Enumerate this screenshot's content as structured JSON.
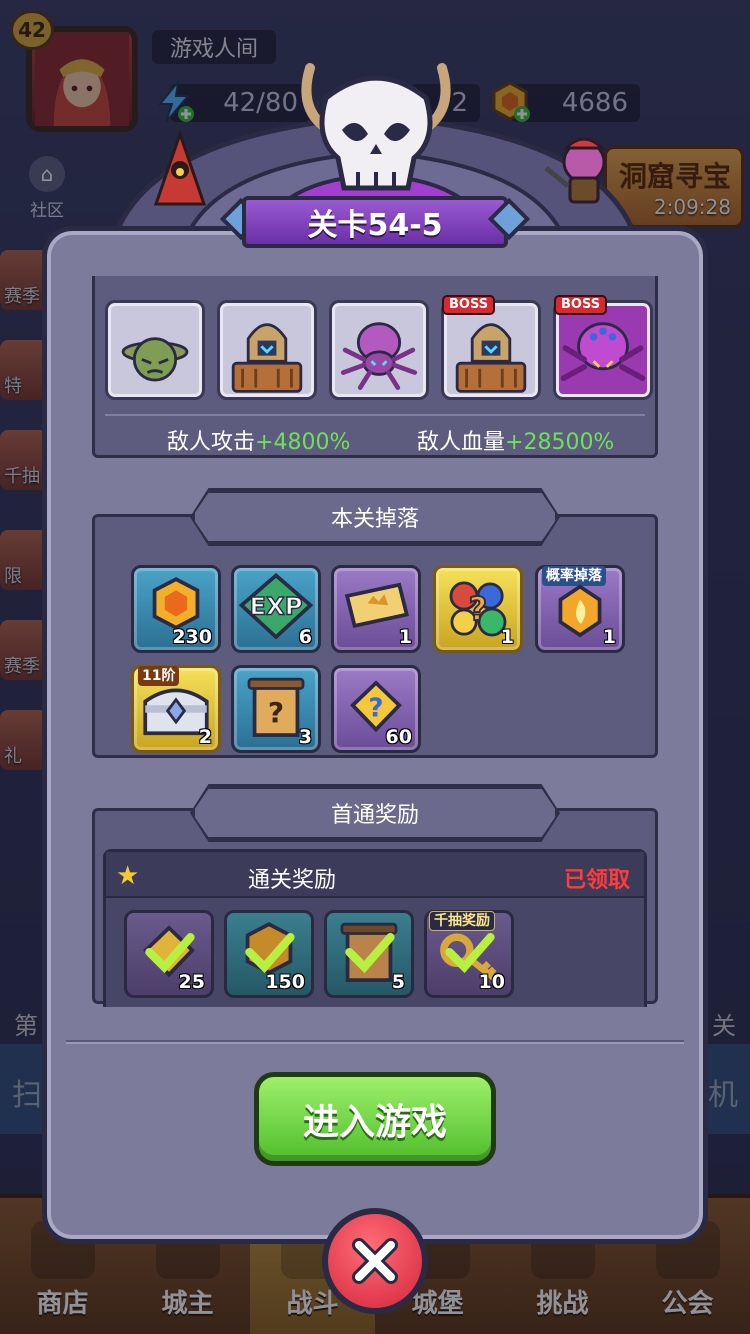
{
  "player": {
    "level": "42",
    "name": "游戏人间"
  },
  "resources": {
    "energy": "42/80",
    "gems_partial": "2",
    "gold": "4686"
  },
  "community_label": "社区",
  "treasure": {
    "title": "洞窟寻宝",
    "timer": "2:09:28"
  },
  "side_labels": [
    "赛季",
    "特",
    "千抽",
    "限",
    "赛季",
    "礼"
  ],
  "background_hints": {
    "left_text": "第",
    "right_text": "关",
    "sweep": "扫",
    "sweep_right": "机"
  },
  "nav": [
    {
      "label": "商店"
    },
    {
      "label": "城主"
    },
    {
      "label": "战斗"
    },
    {
      "label": "城堡"
    },
    {
      "label": "挑战"
    },
    {
      "label": "公会"
    }
  ],
  "stage": {
    "title": "关卡54-5"
  },
  "enemies": [
    {
      "icon": "goblin-icon",
      "boss": false
    },
    {
      "icon": "armored-knight-icon",
      "boss": false
    },
    {
      "icon": "spider-icon",
      "boss": false
    },
    {
      "icon": "armored-knight-icon",
      "boss": true
    },
    {
      "icon": "spider-queen-icon",
      "boss": true
    }
  ],
  "boss_label": "BOSS",
  "enemy_stats": {
    "attack_label": "敌人攻击",
    "attack_value": "+4800%",
    "hp_label": "敌人血量",
    "hp_value": "+28500%"
  },
  "drops": {
    "title": "本关掉落",
    "items": [
      {
        "icon": "gold-coin-icon",
        "count": "230",
        "quality": "blue",
        "tag": ""
      },
      {
        "icon": "exp-icon",
        "count": "6",
        "quality": "blue",
        "tag": ""
      },
      {
        "icon": "ticket-icon",
        "count": "1",
        "quality": "purple",
        "tag": ""
      },
      {
        "icon": "random-gem-icon",
        "count": "1",
        "quality": "gold",
        "tag": ""
      },
      {
        "icon": "fire-badge-icon",
        "count": "1",
        "quality": "purple",
        "tag": "概率掉落"
      },
      {
        "icon": "treasure-chest-icon",
        "count": "2",
        "quality": "gold",
        "tag": "11阶"
      },
      {
        "icon": "scroll-icon",
        "count": "3",
        "quality": "blue",
        "tag": ""
      },
      {
        "icon": "puzzle-piece-icon",
        "count": "60",
        "quality": "purple",
        "tag": ""
      }
    ]
  },
  "first_clear": {
    "title": "首通奖励",
    "reward_title": "通关奖励",
    "status": "已领取",
    "items": [
      {
        "icon": "puzzle-piece-icon",
        "count": "25",
        "quality": "purple",
        "tag": ""
      },
      {
        "icon": "gold-coin-icon",
        "count": "150",
        "quality": "teal",
        "tag": ""
      },
      {
        "icon": "scroll-icon",
        "count": "5",
        "quality": "teal",
        "tag": ""
      },
      {
        "icon": "key-icon",
        "count": "10",
        "quality": "purple",
        "tag": "千抽奖励"
      }
    ]
  },
  "enter_button": "进入游戏",
  "colors": {
    "accent_green": "#6ee05a",
    "claimed_red": "#ff3b3b",
    "title_purple": "#7c3fbd"
  }
}
